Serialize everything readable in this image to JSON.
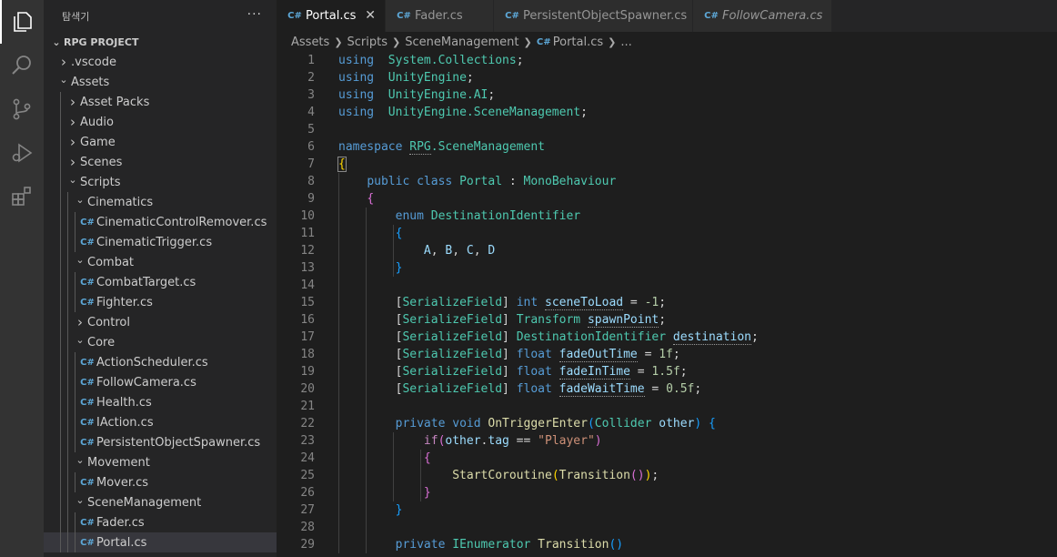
{
  "explorer": {
    "title": "탐색기",
    "more": "···",
    "project": "RPG PROJECT",
    "items": [
      {
        "label": ".vscode",
        "depth": 1,
        "kind": "folder-closed"
      },
      {
        "label": "Assets",
        "depth": 1,
        "kind": "folder-open"
      },
      {
        "label": "Asset Packs",
        "depth": 2,
        "kind": "folder-closed"
      },
      {
        "label": "Audio",
        "depth": 2,
        "kind": "folder-closed"
      },
      {
        "label": "Game",
        "depth": 2,
        "kind": "folder-closed"
      },
      {
        "label": "Scenes",
        "depth": 2,
        "kind": "folder-closed"
      },
      {
        "label": "Scripts",
        "depth": 2,
        "kind": "folder-open"
      },
      {
        "label": "Cinematics",
        "depth": 3,
        "kind": "folder-open"
      },
      {
        "label": "CinematicControlRemover.cs",
        "depth": 4,
        "kind": "file"
      },
      {
        "label": "CinematicTrigger.cs",
        "depth": 4,
        "kind": "file"
      },
      {
        "label": "Combat",
        "depth": 3,
        "kind": "folder-open"
      },
      {
        "label": "CombatTarget.cs",
        "depth": 4,
        "kind": "file"
      },
      {
        "label": "Fighter.cs",
        "depth": 4,
        "kind": "file"
      },
      {
        "label": "Control",
        "depth": 3,
        "kind": "folder-closed"
      },
      {
        "label": "Core",
        "depth": 3,
        "kind": "folder-open"
      },
      {
        "label": "ActionScheduler.cs",
        "depth": 4,
        "kind": "file"
      },
      {
        "label": "FollowCamera.cs",
        "depth": 4,
        "kind": "file"
      },
      {
        "label": "Health.cs",
        "depth": 4,
        "kind": "file"
      },
      {
        "label": "IAction.cs",
        "depth": 4,
        "kind": "file"
      },
      {
        "label": "PersistentObjectSpawner.cs",
        "depth": 4,
        "kind": "file"
      },
      {
        "label": "Movement",
        "depth": 3,
        "kind": "folder-open"
      },
      {
        "label": "Mover.cs",
        "depth": 4,
        "kind": "file"
      },
      {
        "label": "SceneManagement",
        "depth": 3,
        "kind": "folder-open"
      },
      {
        "label": "Fader.cs",
        "depth": 4,
        "kind": "file"
      },
      {
        "label": "Portal.cs",
        "depth": 4,
        "kind": "file",
        "selected": true
      }
    ]
  },
  "tabs": [
    {
      "label": "Portal.cs",
      "active": true,
      "close": "✕"
    },
    {
      "label": "Fader.cs",
      "active": false
    },
    {
      "label": "PersistentObjectSpawner.cs",
      "active": false
    },
    {
      "label": "FollowCamera.cs",
      "active": false,
      "italic": true
    }
  ],
  "breadcrumb": {
    "parts": [
      "Assets",
      "Scripts",
      "SceneManagement"
    ],
    "file": "Portal.cs",
    "tail": "..."
  },
  "icons": {
    "activity": [
      "files-icon",
      "search-icon",
      "source-control-icon",
      "run-debug-icon",
      "extensions-icon"
    ],
    "csharp": "C#"
  },
  "code": [
    [
      [
        "kw",
        "using"
      ],
      [
        "",
        "  "
      ],
      [
        "type",
        "System.Collections"
      ],
      [
        "",
        ";"
      ]
    ],
    [
      [
        "kw",
        "using"
      ],
      [
        "",
        "  "
      ],
      [
        "type",
        "UnityEngine"
      ],
      [
        "",
        ";"
      ]
    ],
    [
      [
        "kw",
        "using"
      ],
      [
        "",
        "  "
      ],
      [
        "type",
        "UnityEngine.AI"
      ],
      [
        "",
        ";"
      ]
    ],
    [
      [
        "kw",
        "using"
      ],
      [
        "",
        "  "
      ],
      [
        "type",
        "UnityEngine.SceneManagement"
      ],
      [
        "",
        ";"
      ]
    ],
    [],
    [
      [
        "kw",
        "namespace"
      ],
      [
        "",
        " "
      ],
      [
        "type sq",
        "RPG"
      ],
      [
        "type",
        ".SceneManagement"
      ]
    ],
    [
      [
        "b1 bracket-match",
        "{"
      ]
    ],
    [
      [
        "",
        "    "
      ],
      [
        "kw",
        "public"
      ],
      [
        "",
        " "
      ],
      [
        "kw",
        "class"
      ],
      [
        "",
        " "
      ],
      [
        "type",
        "Portal"
      ],
      [
        "",
        " : "
      ],
      [
        "type",
        "MonoBehaviour"
      ]
    ],
    [
      [
        "",
        "    "
      ],
      [
        "b2",
        "{"
      ]
    ],
    [
      [
        "",
        "        "
      ],
      [
        "kw",
        "enum"
      ],
      [
        "",
        " "
      ],
      [
        "type",
        "DestinationIdentifier"
      ]
    ],
    [
      [
        "",
        "        "
      ],
      [
        "b3",
        "{"
      ]
    ],
    [
      [
        "",
        "            "
      ],
      [
        "var",
        "A"
      ],
      [
        "",
        ", "
      ],
      [
        "var",
        "B"
      ],
      [
        "",
        ", "
      ],
      [
        "var",
        "C"
      ],
      [
        "",
        ", "
      ],
      [
        "var",
        "D"
      ]
    ],
    [
      [
        "",
        "        "
      ],
      [
        "b3",
        "}"
      ]
    ],
    [],
    [
      [
        "",
        "        "
      ],
      [
        "",
        "["
      ],
      [
        "type",
        "SerializeField"
      ],
      [
        "",
        "] "
      ],
      [
        "kw",
        "int"
      ],
      [
        "",
        " "
      ],
      [
        "var sq",
        "sceneToLoad"
      ],
      [
        "",
        " = "
      ],
      [
        "num",
        "-1"
      ],
      [
        "",
        ";"
      ]
    ],
    [
      [
        "",
        "        "
      ],
      [
        "",
        "["
      ],
      [
        "type",
        "SerializeField"
      ],
      [
        "",
        "] "
      ],
      [
        "type",
        "Transform"
      ],
      [
        "",
        " "
      ],
      [
        "var sq",
        "spawnPoint"
      ],
      [
        "",
        ";"
      ]
    ],
    [
      [
        "",
        "        "
      ],
      [
        "",
        "["
      ],
      [
        "type",
        "SerializeField"
      ],
      [
        "",
        "] "
      ],
      [
        "type",
        "DestinationIdentifier"
      ],
      [
        "",
        " "
      ],
      [
        "var sq",
        "destination"
      ],
      [
        "",
        ";"
      ]
    ],
    [
      [
        "",
        "        "
      ],
      [
        "",
        "["
      ],
      [
        "type",
        "SerializeField"
      ],
      [
        "",
        "] "
      ],
      [
        "kw",
        "float"
      ],
      [
        "",
        " "
      ],
      [
        "var sq",
        "fadeOutTime"
      ],
      [
        "",
        " = "
      ],
      [
        "num",
        "1f"
      ],
      [
        "",
        ";"
      ]
    ],
    [
      [
        "",
        "        "
      ],
      [
        "",
        "["
      ],
      [
        "type",
        "SerializeField"
      ],
      [
        "",
        "] "
      ],
      [
        "kw",
        "float"
      ],
      [
        "",
        " "
      ],
      [
        "var sq",
        "fadeInTime"
      ],
      [
        "",
        " = "
      ],
      [
        "num",
        "1.5f"
      ],
      [
        "",
        ";"
      ]
    ],
    [
      [
        "",
        "        "
      ],
      [
        "",
        "["
      ],
      [
        "type",
        "SerializeField"
      ],
      [
        "",
        "] "
      ],
      [
        "kw",
        "float"
      ],
      [
        "",
        " "
      ],
      [
        "var sq",
        "fadeWaitTime"
      ],
      [
        "",
        " = "
      ],
      [
        "num",
        "0.5f"
      ],
      [
        "",
        ";"
      ]
    ],
    [],
    [
      [
        "",
        "        "
      ],
      [
        "kw",
        "private"
      ],
      [
        "",
        " "
      ],
      [
        "kw",
        "void"
      ],
      [
        "",
        " "
      ],
      [
        "fn",
        "OnTriggerEnter"
      ],
      [
        "b3",
        "("
      ],
      [
        "type",
        "Collider"
      ],
      [
        "",
        " "
      ],
      [
        "var",
        "other"
      ],
      [
        "b3",
        ")"
      ],
      [
        "",
        " "
      ],
      [
        "b3",
        "{"
      ]
    ],
    [
      [
        "",
        "            "
      ],
      [
        "ctrl",
        "if"
      ],
      [
        "b2",
        "("
      ],
      [
        "var",
        "other"
      ],
      [
        "",
        "."
      ],
      [
        "var",
        "tag"
      ],
      [
        "",
        " == "
      ],
      [
        "str",
        "\"Player\""
      ],
      [
        "b2",
        ")"
      ]
    ],
    [
      [
        "",
        "            "
      ],
      [
        "b2",
        "{"
      ]
    ],
    [
      [
        "",
        "                "
      ],
      [
        "fn",
        "StartCoroutine"
      ],
      [
        "b1",
        "("
      ],
      [
        "fn",
        "Transition"
      ],
      [
        "b2",
        "()"
      ],
      [
        "b1",
        ")"
      ],
      [
        "",
        ";"
      ]
    ],
    [
      [
        "",
        "            "
      ],
      [
        "b2",
        "}"
      ]
    ],
    [
      [
        "",
        "        "
      ],
      [
        "b3",
        "}"
      ]
    ],
    [],
    [
      [
        "",
        "        "
      ],
      [
        "kw",
        "private"
      ],
      [
        "",
        " "
      ],
      [
        "type",
        "IEnumerator"
      ],
      [
        "",
        " "
      ],
      [
        "fn",
        "Transition"
      ],
      [
        "b3",
        "()"
      ]
    ]
  ]
}
